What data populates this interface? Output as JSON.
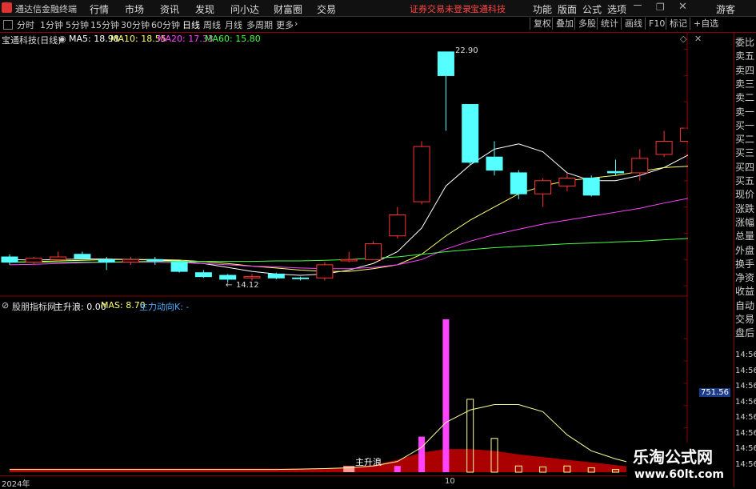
{
  "app": {
    "title": "通达信金融终端"
  },
  "menu": [
    "行情",
    "市场",
    "资讯",
    "发现",
    "问小达",
    "财富圈",
    "交易"
  ],
  "alert": {
    "left": "证券交易未登录",
    "right": "宝通科技"
  },
  "menu_right": [
    "功能",
    "版面",
    "公式",
    "选项",
    "游客"
  ],
  "periods": [
    "分时",
    "1分钟",
    "5分钟",
    "15分钟",
    "30分钟",
    "60分钟",
    "日线",
    "周线",
    "月线",
    "多周期",
    "更多"
  ],
  "active_period": "日线",
  "toolbar_right": [
    "复权",
    "叠加",
    "多股",
    "统计",
    "画线",
    "F10",
    "标记",
    "+自选"
  ],
  "stock_title": "宝通科技(日线)",
  "ma_legend": [
    {
      "label": "MA5: 18.98",
      "color": "#ffffff"
    },
    {
      "label": "MA10: 18.55",
      "color": "#ffff66"
    },
    {
      "label": "MA20: 17.33",
      "color": "#ff44ff"
    },
    {
      "label": "MA60: 15.80",
      "color": "#44ff44"
    }
  ],
  "sub_title": "股朋指标网",
  "sub_legend": [
    {
      "label": "主升浪: 0.00",
      "color": "#ffffff"
    },
    {
      "label": "MAS: 8.70",
      "color": "#ffff66"
    },
    {
      "label": "主力动向K: -",
      "color": "#44aaff"
    }
  ],
  "annotation_high": "22.90",
  "annotation_low": "14.12",
  "zhushenglang_label": "主升浪",
  "current_value_tag": "751.56",
  "xaxis": {
    "year": "2024年",
    "month": "10"
  },
  "right_panel": [
    "委比",
    "卖五",
    "卖四",
    "卖三",
    "卖二",
    "卖一",
    "买一",
    "买二",
    "买三",
    "买四",
    "买五",
    "现价",
    "涨跌",
    "涨幅",
    "总量",
    "外盘",
    "换手",
    "净资",
    "收益",
    "自动",
    "交易",
    "盘后"
  ],
  "right_panel_times": [
    "14:56",
    "14:56",
    "14:56",
    "14:56",
    "14:56",
    "14:56",
    "14:56",
    "14:56"
  ],
  "watermark": {
    "line1": "乐淘公式网",
    "line2": "www.60lt.com"
  },
  "chart_data": [
    {
      "type": "candlestick",
      "title": "宝通科技(日线)",
      "y_ticks": [
        "23.00",
        "22.00",
        "21.00",
        "20.00",
        "19.00",
        "18.00",
        "17.00",
        "16.00",
        "15.00",
        "14.00"
      ],
      "ylim": [
        13.7,
        23.2
      ],
      "candles": [
        {
          "o": 15.1,
          "c": 14.9,
          "h": 15.2,
          "l": 14.8
        },
        {
          "o": 14.9,
          "c": 15.05,
          "h": 15.1,
          "l": 14.8
        },
        {
          "o": 15.0,
          "c": 15.1,
          "h": 15.3,
          "l": 14.9
        },
        {
          "o": 15.2,
          "c": 15.05,
          "h": 15.3,
          "l": 15.0
        },
        {
          "o": 15.0,
          "c": 14.9,
          "h": 15.1,
          "l": 14.6
        },
        {
          "o": 14.9,
          "c": 15.0,
          "h": 15.1,
          "l": 14.8
        },
        {
          "o": 15.0,
          "c": 14.95,
          "h": 15.1,
          "l": 14.8
        },
        {
          "o": 14.9,
          "c": 14.55,
          "h": 15.0,
          "l": 14.5
        },
        {
          "o": 14.5,
          "c": 14.35,
          "h": 14.6,
          "l": 14.3
        },
        {
          "o": 14.4,
          "c": 14.25,
          "h": 14.45,
          "l": 14.12
        },
        {
          "o": 14.3,
          "c": 14.35,
          "h": 14.45,
          "l": 14.2
        },
        {
          "o": 14.45,
          "c": 14.3,
          "h": 14.5,
          "l": 14.25
        },
        {
          "o": 14.3,
          "c": 14.28,
          "h": 14.35,
          "l": 14.2
        },
        {
          "o": 14.3,
          "c": 14.8,
          "h": 14.9,
          "l": 14.2
        },
        {
          "o": 14.95,
          "c": 15.0,
          "h": 15.3,
          "l": 14.9
        },
        {
          "o": 15.0,
          "c": 15.6,
          "h": 15.7,
          "l": 15.0
        },
        {
          "o": 15.9,
          "c": 16.7,
          "h": 17.0,
          "l": 15.8
        },
        {
          "o": 17.2,
          "c": 19.3,
          "h": 19.5,
          "l": 17.1
        },
        {
          "o": 22.9,
          "c": 22.0,
          "h": 22.9,
          "l": 19.9
        },
        {
          "o": 20.9,
          "c": 18.7,
          "h": 20.9,
          "l": 18.6
        },
        {
          "o": 18.9,
          "c": 18.4,
          "h": 19.5,
          "l": 18.2
        },
        {
          "o": 18.3,
          "c": 17.5,
          "h": 18.4,
          "l": 17.3
        },
        {
          "o": 17.5,
          "c": 18.0,
          "h": 18.1,
          "l": 17.0
        },
        {
          "o": 17.8,
          "c": 18.1,
          "h": 18.3,
          "l": 17.6
        },
        {
          "o": 18.1,
          "c": 17.45,
          "h": 18.2,
          "l": 17.4
        },
        {
          "o": 18.35,
          "c": 18.3,
          "h": 18.8,
          "l": 18.2
        },
        {
          "o": 18.3,
          "c": 18.85,
          "h": 19.2,
          "l": 18.0
        },
        {
          "o": 19.0,
          "c": 19.5,
          "h": 19.9,
          "l": 18.9
        },
        {
          "o": 19.5,
          "c": 20.0,
          "h": 21.0,
          "l": 19.4
        }
      ],
      "series": [
        {
          "name": "MA5",
          "color": "#ffffff",
          "values": [
            15.0,
            14.98,
            15.0,
            15.02,
            15.02,
            15.0,
            14.98,
            14.95,
            14.85,
            14.7,
            14.55,
            14.45,
            14.4,
            14.45,
            14.6,
            14.85,
            15.3,
            16.2,
            17.8,
            18.6,
            19.2,
            19.4,
            19.1,
            18.3,
            18.0,
            18.0,
            18.2,
            18.5,
            18.98
          ]
        },
        {
          "name": "MA10",
          "color": "#ffff66",
          "values": [
            14.9,
            14.92,
            14.95,
            14.97,
            15.0,
            15.0,
            15.0,
            14.98,
            14.92,
            14.85,
            14.75,
            14.68,
            14.6,
            14.55,
            14.55,
            14.65,
            14.8,
            15.2,
            15.9,
            16.5,
            17.0,
            17.5,
            17.8,
            18.0,
            18.1,
            18.2,
            18.35,
            18.5,
            18.55
          ]
        },
        {
          "name": "MA20",
          "color": "#ff44ff",
          "values": [
            14.8,
            14.82,
            14.85,
            14.88,
            14.9,
            14.9,
            14.9,
            14.88,
            14.85,
            14.8,
            14.75,
            14.72,
            14.68,
            14.65,
            14.65,
            14.7,
            14.8,
            15.0,
            15.4,
            15.7,
            15.95,
            16.15,
            16.35,
            16.5,
            16.65,
            16.8,
            16.95,
            17.15,
            17.33
          ]
        },
        {
          "name": "MA60",
          "color": "#44ff44",
          "values": [
            14.9,
            14.9,
            14.9,
            14.9,
            14.9,
            14.92,
            14.93,
            14.93,
            14.93,
            14.93,
            14.93,
            14.95,
            14.95,
            14.97,
            15.0,
            15.05,
            15.1,
            15.2,
            15.3,
            15.38,
            15.45,
            15.5,
            15.55,
            15.6,
            15.63,
            15.67,
            15.7,
            15.75,
            15.8
          ]
        }
      ]
    },
    {
      "type": "bar",
      "title": "股朋指标网",
      "y_ticks": [
        "1500",
        "1250",
        "1000",
        "750",
        "500",
        "250"
      ],
      "ylim": [
        0,
        1800
      ],
      "bars": [
        {
          "index": 16,
          "value": 70,
          "color": "#ff44ff"
        },
        {
          "index": 17,
          "value": 400,
          "color": "#ff44ff"
        },
        {
          "index": 18,
          "value": 1720,
          "color": "#ff44ff"
        },
        {
          "index": 19,
          "value": 820,
          "color": "#ffff99",
          "hollow": true
        },
        {
          "index": 20,
          "value": 380,
          "color": "#ffff99",
          "hollow": true
        },
        {
          "index": 21,
          "value": 70,
          "color": "#ffff99",
          "hollow": true
        },
        {
          "index": 22,
          "value": 60,
          "color": "#ffff99",
          "hollow": true
        },
        {
          "index": 23,
          "value": 70,
          "color": "#ffff99",
          "hollow": true
        },
        {
          "index": 24,
          "value": 50,
          "color": "#ffff99",
          "hollow": true
        },
        {
          "index": 25,
          "value": 30,
          "color": "#ffff99",
          "hollow": true
        },
        {
          "index": 14,
          "value": 70,
          "color": "#ff9999"
        }
      ],
      "line_values": [
        30,
        30,
        30,
        30,
        30,
        30,
        30,
        30,
        30,
        30,
        30,
        30,
        35,
        40,
        50,
        70,
        120,
        280,
        560,
        700,
        760,
        760,
        680,
        420,
        240,
        150,
        80,
        40,
        30
      ],
      "area_values": [
        40,
        40,
        40,
        40,
        40,
        40,
        40,
        40,
        40,
        40,
        40,
        40,
        40,
        45,
        55,
        80,
        140,
        220,
        260,
        260,
        240,
        200,
        170,
        140,
        110,
        80,
        50,
        30,
        10
      ]
    }
  ]
}
